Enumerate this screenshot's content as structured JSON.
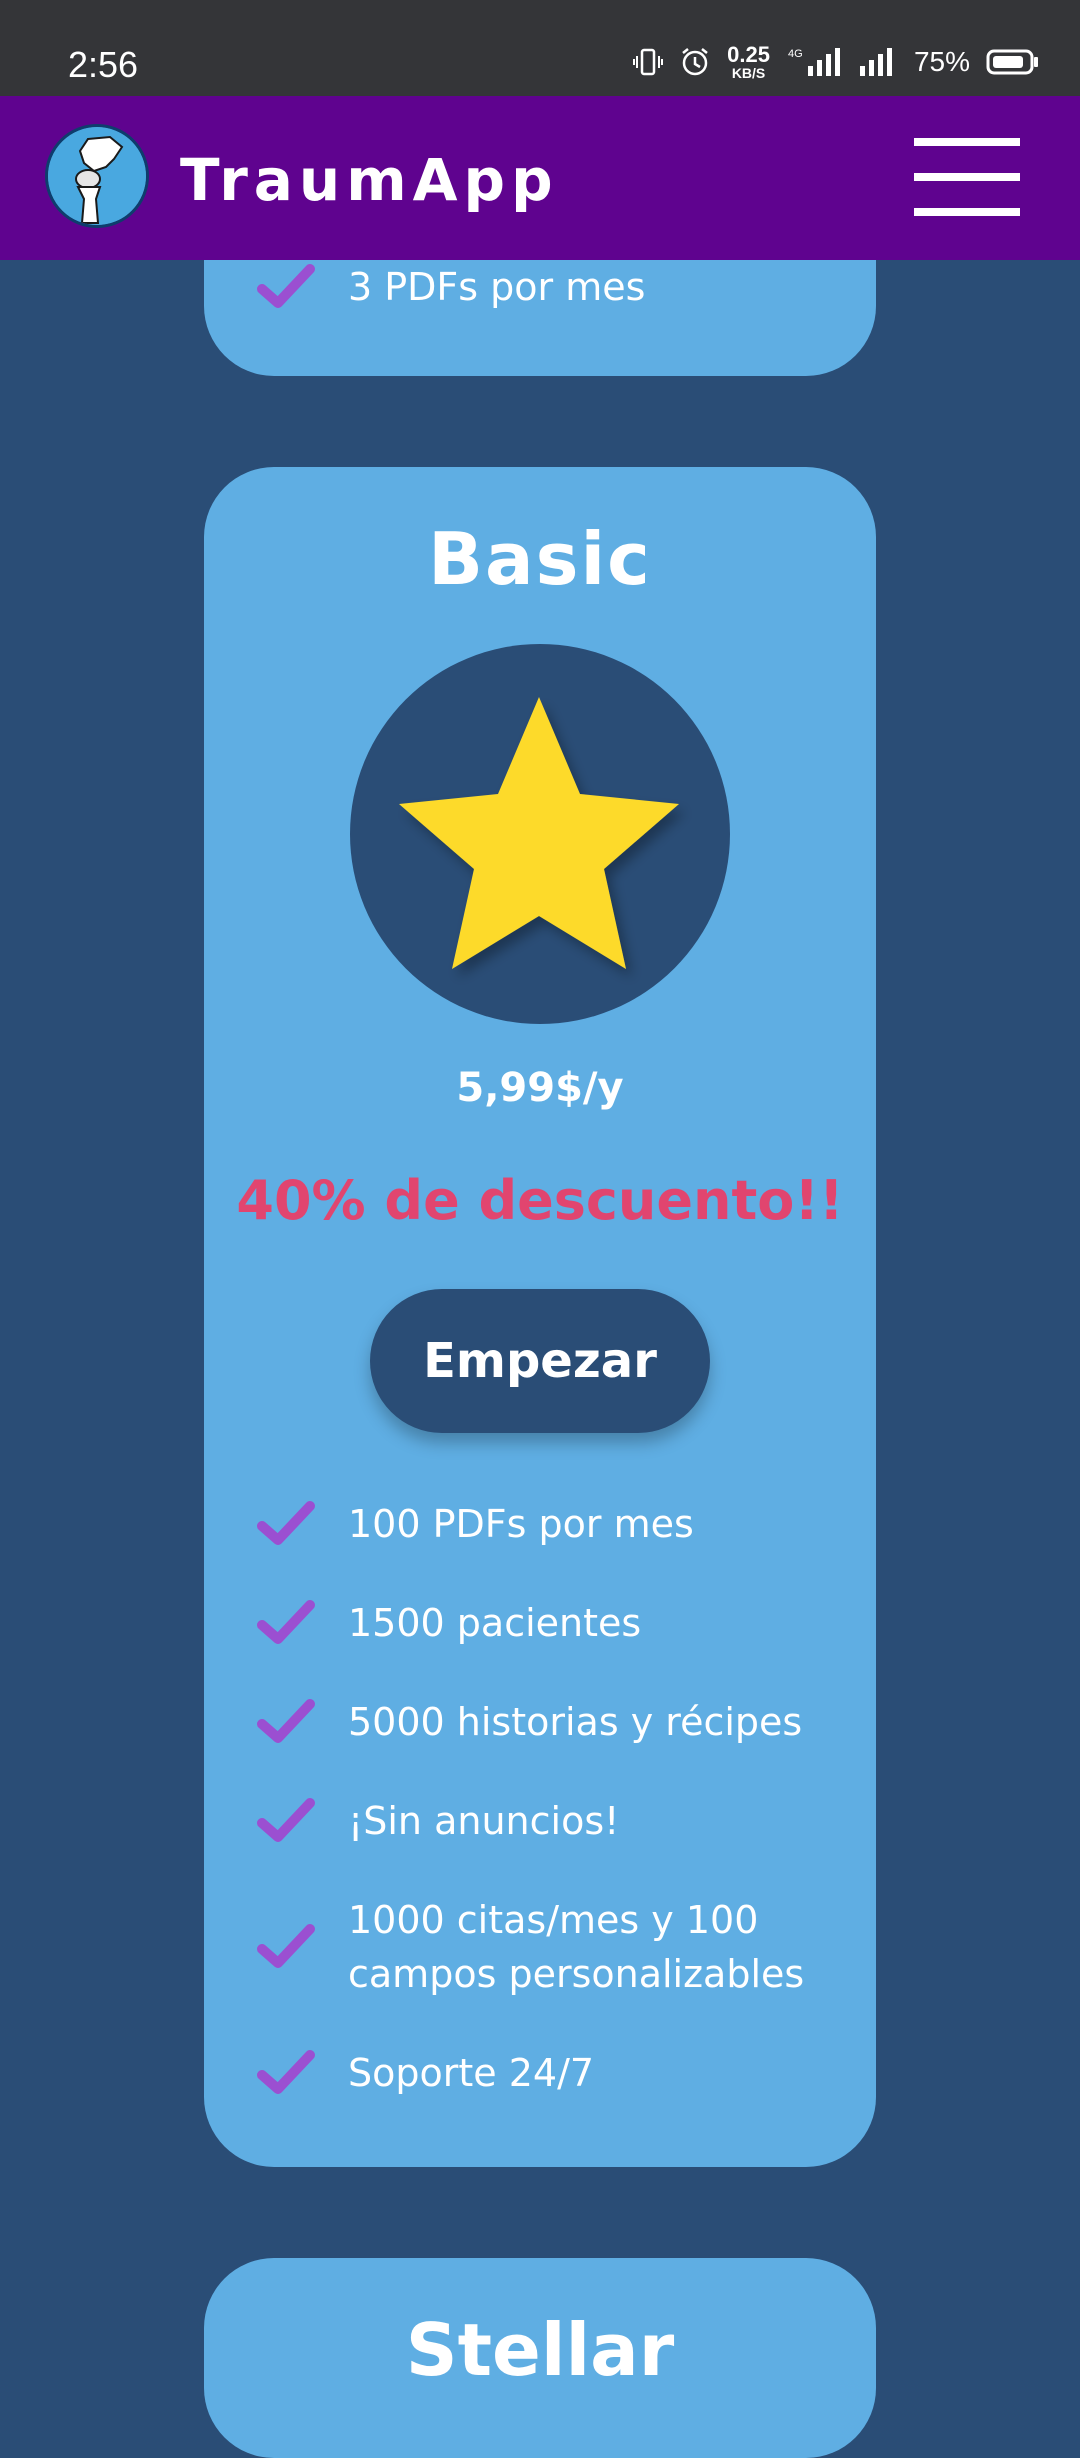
{
  "status_bar": {
    "time": "2:56",
    "net_speed_value": "0.25",
    "net_speed_unit": "KB/S",
    "network": "4G",
    "battery": "75%"
  },
  "app_bar": {
    "title": "TraumApp",
    "logo_icon": "knee-joint-logo",
    "menu_icon": "hamburger-menu-icon",
    "color": "#5f038f"
  },
  "previous_card": {
    "features": [
      "3 PDFs por mes"
    ]
  },
  "basic_card": {
    "title": "Basic",
    "icon": "star-icon",
    "price": "5,99$/y",
    "discount": "40% de descuento!!",
    "button": "Empezar",
    "features": [
      "100 PDFs por mes",
      "1500 pacientes",
      "5000 historias y récipes",
      "¡Sin anuncios!",
      "1000 citas/mes y 100",
      "campos personalizables",
      "Soporte 24/7"
    ]
  },
  "next_card": {
    "title": "Stellar"
  },
  "colors": {
    "background": "#2a4d76",
    "card": "#5faee3",
    "check": "#9b4fd1",
    "discount": "#e1456f",
    "star": "#fdda2c"
  }
}
